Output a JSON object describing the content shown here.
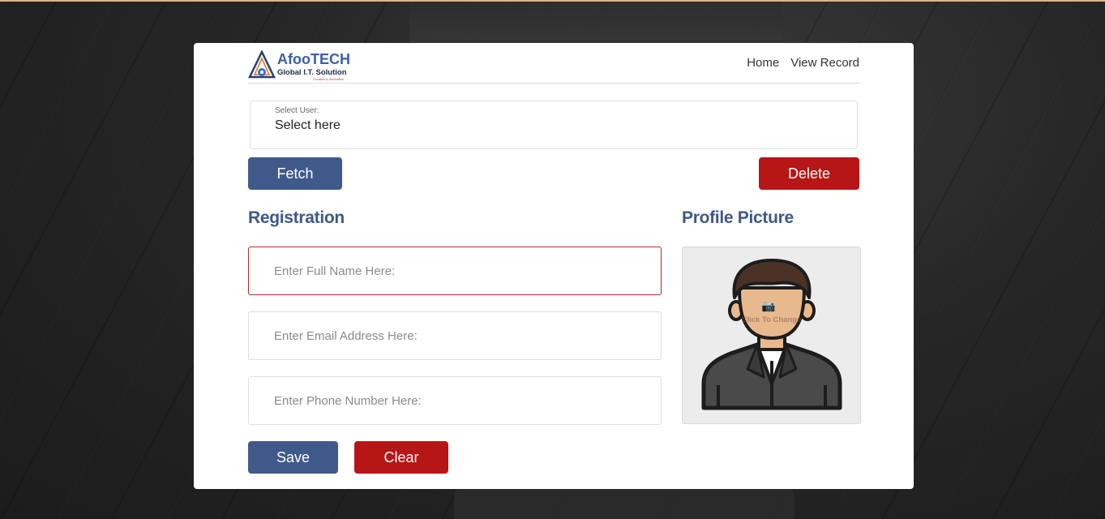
{
  "brand": {
    "name": "AfooTECH",
    "tagline": "Global I.T. Solution",
    "slogan": "Creative & Innovative"
  },
  "nav": {
    "items": [
      {
        "label": "Home"
      },
      {
        "label": "View Record"
      }
    ]
  },
  "user_select": {
    "label": "Select User:",
    "value": "Select here"
  },
  "actions": {
    "fetch_label": "Fetch",
    "delete_label": "Delete"
  },
  "registration": {
    "heading": "Registration",
    "full_name": {
      "placeholder": "Enter Full Name Here:",
      "value": ""
    },
    "email": {
      "placeholder": "Enter Email Address Here:",
      "value": ""
    },
    "phone": {
      "placeholder": "Enter Phone Number Here:",
      "value": ""
    },
    "save_label": "Save",
    "clear_label": "Clear"
  },
  "profile": {
    "heading": "Profile Picture",
    "change_hint": "Click To Change",
    "camera_icon": "camera-icon"
  },
  "colors": {
    "primary": "#3f5a8a",
    "danger": "#b71616",
    "heading": "#3e5888"
  }
}
